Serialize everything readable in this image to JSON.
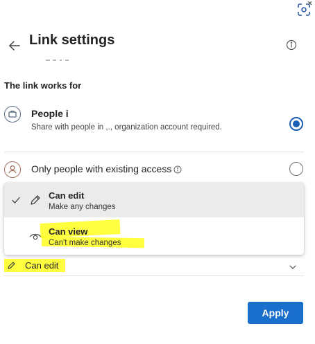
{
  "header": {
    "title": "Link settings"
  },
  "section": {
    "label": "The link works for"
  },
  "options": {
    "people": {
      "title": "People i",
      "desc": "Share with people in ,., organization account required.",
      "selected": true
    },
    "existing": {
      "title": "Only people with existing access",
      "selected": false
    }
  },
  "menu": {
    "edit": {
      "title": "Can edit",
      "desc": "Make any changes",
      "checked": true
    },
    "view": {
      "title": "Can view",
      "desc": "Can't make changes",
      "checked": false
    }
  },
  "permission": {
    "label": "Can edit"
  },
  "footer": {
    "apply_label": "Apply"
  },
  "colors": {
    "accent": "#1a6fcc",
    "highlight": "#ffff1f",
    "menu_hover": "#ebebeb"
  },
  "icons": {
    "scan": "scan-icon",
    "back": "back-arrow-icon",
    "info": "info-icon",
    "people": "briefcase-icon",
    "existing": "person-icon",
    "check": "check-icon",
    "edit": "pencil-icon",
    "view": "eye-icon",
    "chevron": "chevron-down-icon"
  }
}
